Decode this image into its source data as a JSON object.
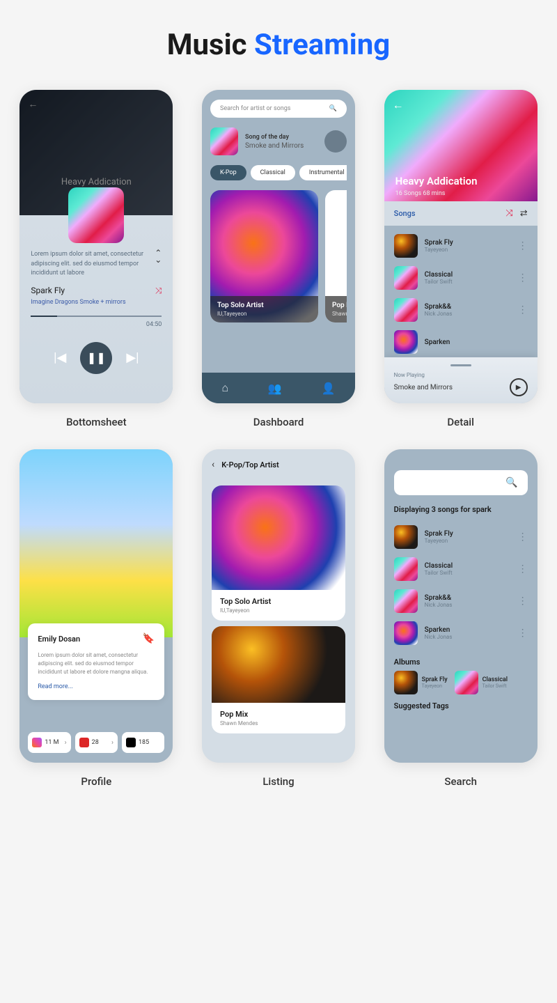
{
  "page_title": {
    "word1": "Music",
    "word2": "Streaming"
  },
  "captions": {
    "bottomsheet": "Bottomsheet",
    "dashboard": "Dashboard",
    "detail": "Detail",
    "profile": "Profile",
    "listing": "Listing",
    "search": "Search"
  },
  "bottomsheet": {
    "album_title": "Heavy Addication",
    "description": "Lorem ipsum dolor sit amet, consectetur adipiscing elit. sed do eiusmod tempor incididunt ut labore",
    "song_title": "Spark Fly",
    "artist": "Imagine Dragons Smoke + mirrors",
    "duration": "04:50"
  },
  "dashboard": {
    "search_placeholder": "Search for artist or songs",
    "sod_label": "Song of the day",
    "sod_song": "Smoke and Mirrors",
    "chips": [
      "K-Pop",
      "Classical",
      "Instrumental"
    ],
    "cards": [
      {
        "title": "Top Solo Artist",
        "sub": "IU,Tayeyeon"
      },
      {
        "title": "Pop Mix",
        "sub": "Shawn Me"
      }
    ]
  },
  "detail": {
    "title": "Heavy Addication",
    "sub": "16 Songs 68 mins",
    "section_label": "Songs",
    "songs": [
      {
        "title": "Sprak Fly",
        "artist": "Tayeyeon"
      },
      {
        "title": "Classical",
        "artist": "Tailor Swift"
      },
      {
        "title": "Sprak&&",
        "artist": "Nick Jonas"
      },
      {
        "title": "Sparken",
        "artist": ""
      }
    ],
    "now_playing_label": "Now Playing",
    "now_playing_song": "Smoke and Mirrors"
  },
  "profile": {
    "name": "Emily Dosan",
    "description": "Lorem ipsum dolor sit amet, consectetur adipiscing elit. sed do eiusmod tempor incididunt ut labore et dolore mangna aliqua.",
    "readmore": "Read more...",
    "social": [
      {
        "platform": "instagram",
        "count": "11 M"
      },
      {
        "platform": "youtube",
        "count": "28"
      },
      {
        "platform": "twitter",
        "count": "185"
      }
    ]
  },
  "listing": {
    "breadcrumb": "K-Pop/Top Artist",
    "cards": [
      {
        "title": "Top Solo Artist",
        "sub": "IU,Tayeyeon"
      },
      {
        "title": "Pop Mix",
        "sub": "Shawn Mendes"
      }
    ]
  },
  "search": {
    "result_label": "Displaying 3 songs for spark",
    "songs": [
      {
        "title": "Sprak Fly",
        "artist": "Tayeyeon"
      },
      {
        "title": "Classical",
        "artist": "Tailor Swift"
      },
      {
        "title": "Sprak&&",
        "artist": "Nick Jonas"
      },
      {
        "title": "Sparken",
        "artist": "Nick Jonas"
      }
    ],
    "albums_label": "Albums",
    "albums": [
      {
        "title": "Sprak Fly",
        "artist": "Tayeyeon"
      },
      {
        "title": "Classical",
        "artist": "Tailor Swift"
      }
    ],
    "tags_label": "Suggested Tags"
  }
}
